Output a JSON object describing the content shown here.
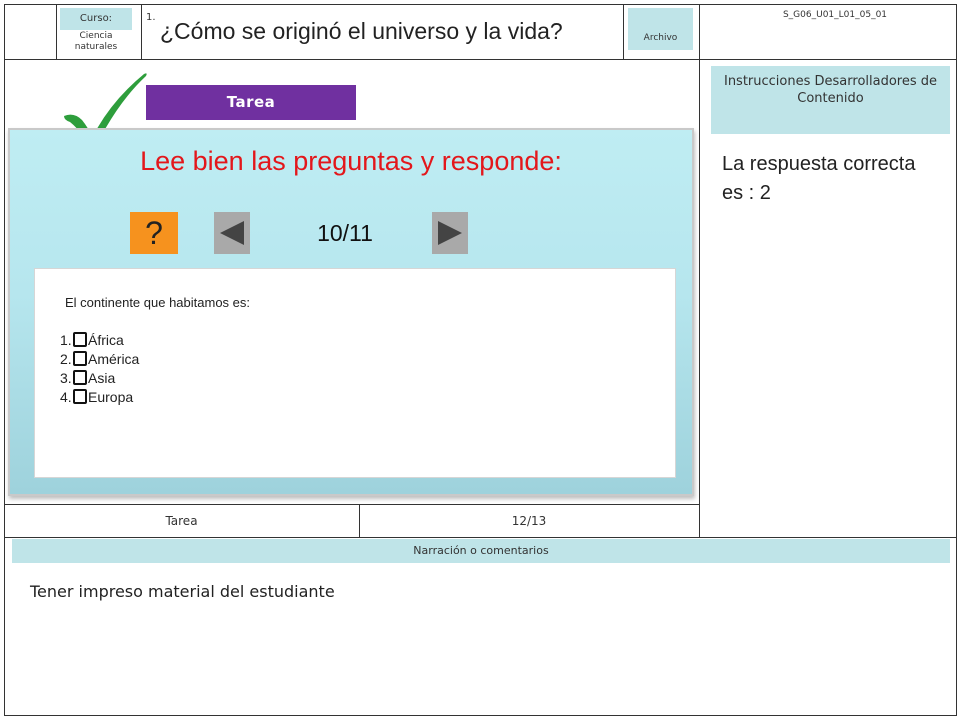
{
  "header": {
    "curso_label": "Curso:",
    "curso_value": "Ciencia naturales",
    "number": "1.",
    "title": "¿Cómo se originó el universo y la vida?",
    "archivo_label": "Archivo",
    "code": "S_G06_U01_L01_05_01"
  },
  "banner": {
    "label": "Tarea"
  },
  "activity": {
    "heading": "Lee bien las preguntas y responde:",
    "help_label": "?",
    "counter": "10/11",
    "question": "El continente que habitamos es:",
    "options": [
      {
        "num": "1.",
        "label": "África"
      },
      {
        "num": "2.",
        "label": "América"
      },
      {
        "num": "3.",
        "label": "Asia"
      },
      {
        "num": "4.",
        "label": "Europa"
      }
    ]
  },
  "sidebar": {
    "instructions_label": "Instrucciones Desarrolladores de Contenido",
    "answer_text": "La respuesta correcta es : 2"
  },
  "footer": {
    "tarea_label": "Tarea",
    "page": "12/13",
    "narration_label": "Narración o comentarios",
    "notes": "Tener impreso material del estudiante"
  },
  "colors": {
    "accent_purple": "#7030a0",
    "heading_red": "#e3171b",
    "check_green": "#2e9e3c",
    "help_orange": "#f6921e",
    "label_bg": "#bfe4e8"
  }
}
